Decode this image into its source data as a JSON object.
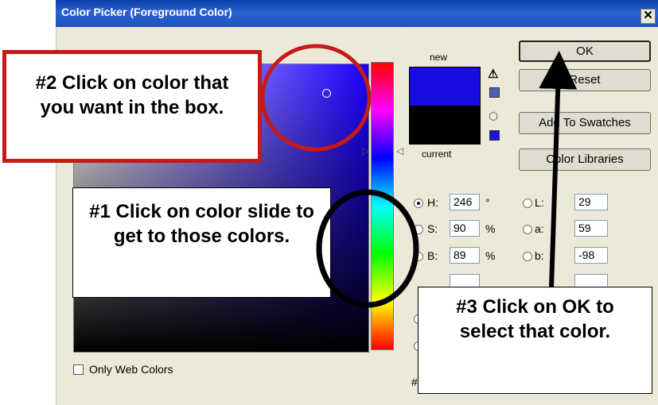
{
  "window": {
    "title": "Color Picker (Foreground Color)",
    "close_glyph": "✕"
  },
  "preview": {
    "new_label": "new",
    "current_label": "current",
    "new_color": "#1a0be3",
    "current_color": "#000000"
  },
  "buttons": {
    "ok": "OK",
    "reset": "Reset",
    "add_to_swatches": "Add To Swatches",
    "color_libraries": "Color Libraries"
  },
  "hsb": {
    "h": {
      "label": "H:",
      "value": "246",
      "unit": "°"
    },
    "s": {
      "label": "S:",
      "value": "90",
      "unit": "%"
    },
    "b": {
      "label": "B:",
      "value": "89",
      "unit": "%"
    }
  },
  "lab": {
    "l": {
      "label": "L:",
      "value": "29"
    },
    "a": {
      "label": "a:",
      "value": "59"
    },
    "b": {
      "label": "b:",
      "value": "-98"
    }
  },
  "misc": {
    "only_web_colors": "Only Web Colors",
    "hash": "#"
  },
  "icons": [
    "warning-icon",
    "cube-icon",
    "close-icon"
  ],
  "callouts": {
    "step2": "#2 Click on color that you want in the box.",
    "step1": "#1 Click on color slide to get to those colors.",
    "step3": "#3 Click on OK to select that color."
  },
  "colors": {
    "callout_red": "#c81818",
    "arrow": "#000000",
    "titlebar": "#0a3fa8"
  }
}
